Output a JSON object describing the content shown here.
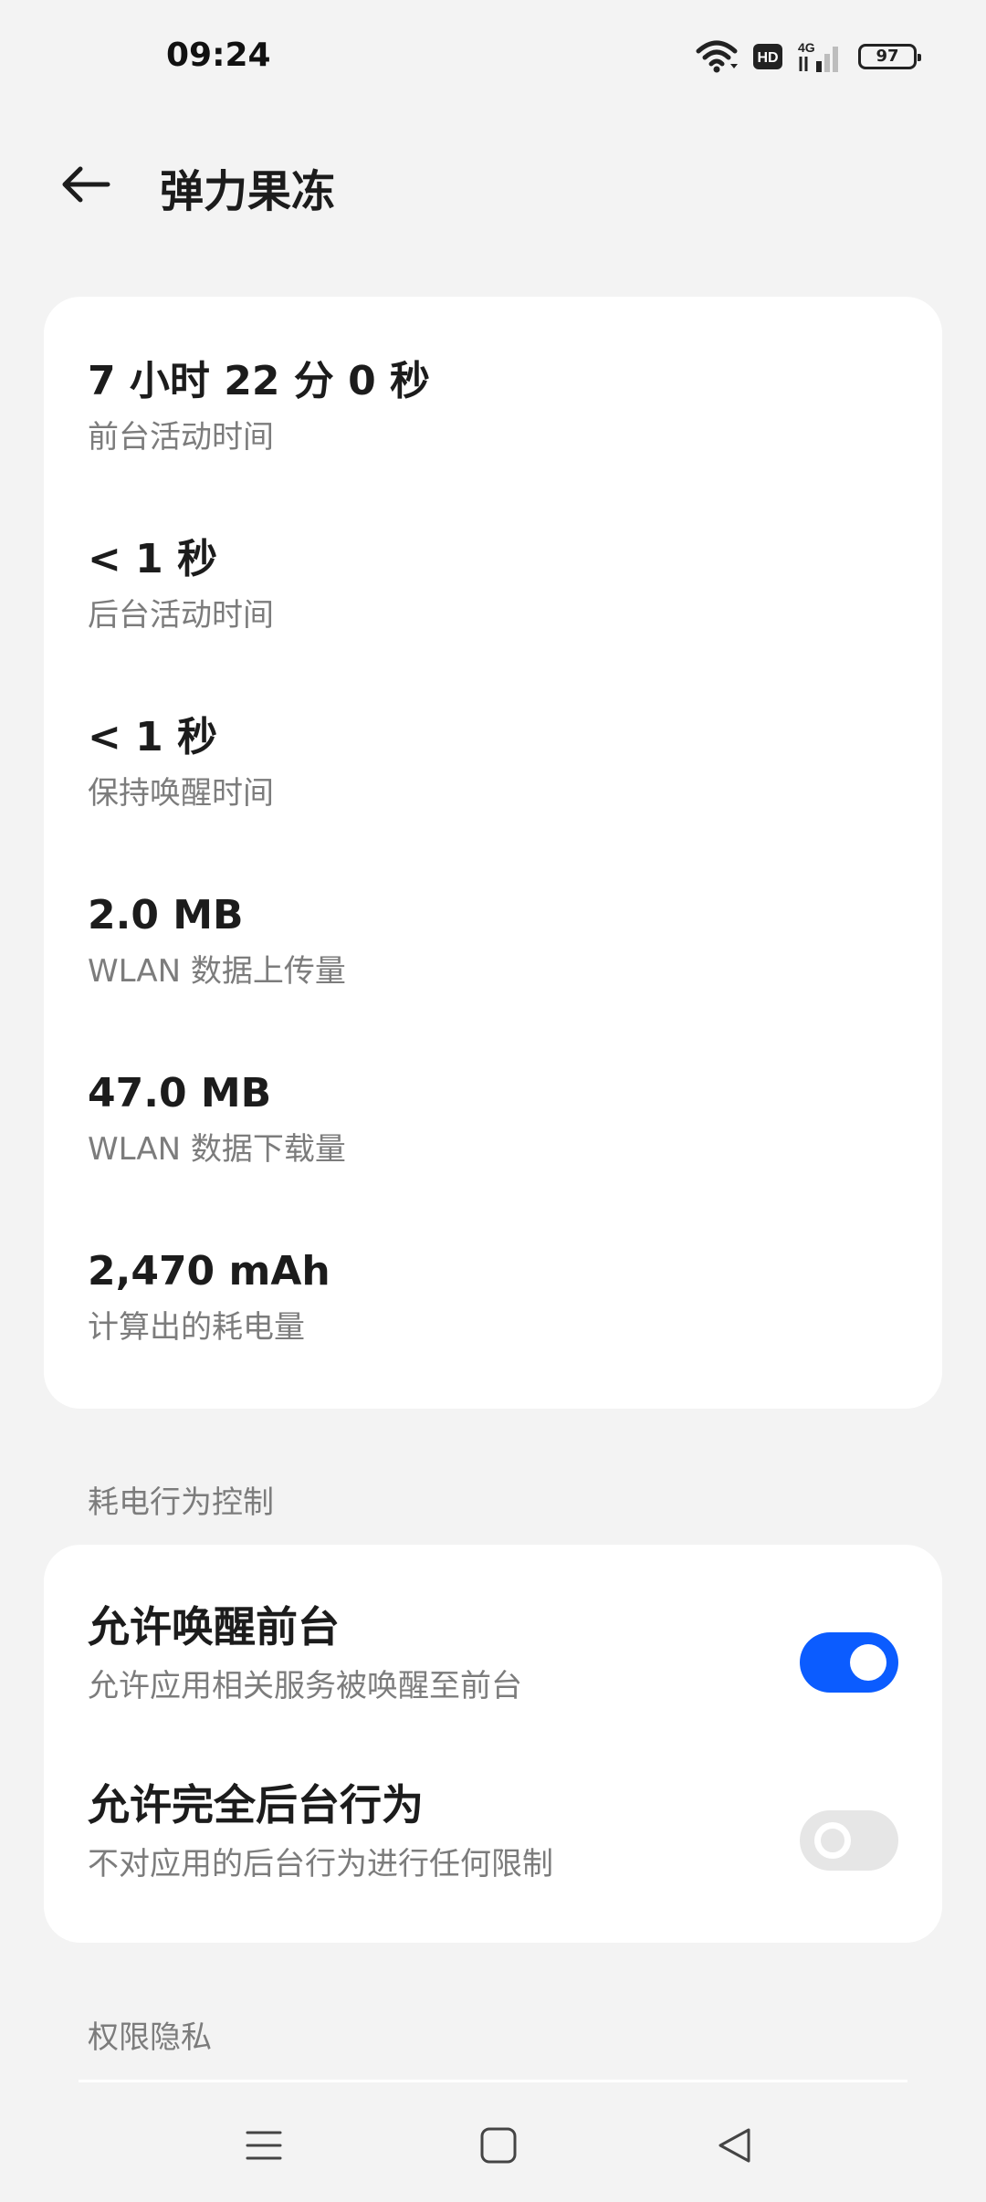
{
  "status_bar": {
    "time": "09:24",
    "hd_label": "HD",
    "network_label": "4G",
    "battery_level": "97"
  },
  "header": {
    "title": "弹力果冻"
  },
  "stats": [
    {
      "value": "7 小时 22 分 0 秒",
      "label": "前台活动时间"
    },
    {
      "value": "< 1 秒",
      "label": "后台活动时间"
    },
    {
      "value": "< 1 秒",
      "label": "保持唤醒时间"
    },
    {
      "value": "2.0 MB",
      "label": "WLAN 数据上传量"
    },
    {
      "value": "47.0 MB",
      "label": "WLAN 数据下载量"
    },
    {
      "value": "2,470 mAh",
      "label": "计算出的耗电量"
    }
  ],
  "power_control": {
    "section_title": "耗电行为控制",
    "items": [
      {
        "title": "允许唤醒前台",
        "description": "允许应用相关服务被唤醒至前台",
        "enabled": true
      },
      {
        "title": "允许完全后台行为",
        "description": "不对应用的后台行为进行任何限制",
        "enabled": false
      }
    ]
  },
  "privacy": {
    "section_title": "权限隐私"
  },
  "colors": {
    "accent": "#0b5cff",
    "background": "#f3f3f3",
    "card": "#ffffff",
    "secondary_text": "#7c7c7c"
  }
}
